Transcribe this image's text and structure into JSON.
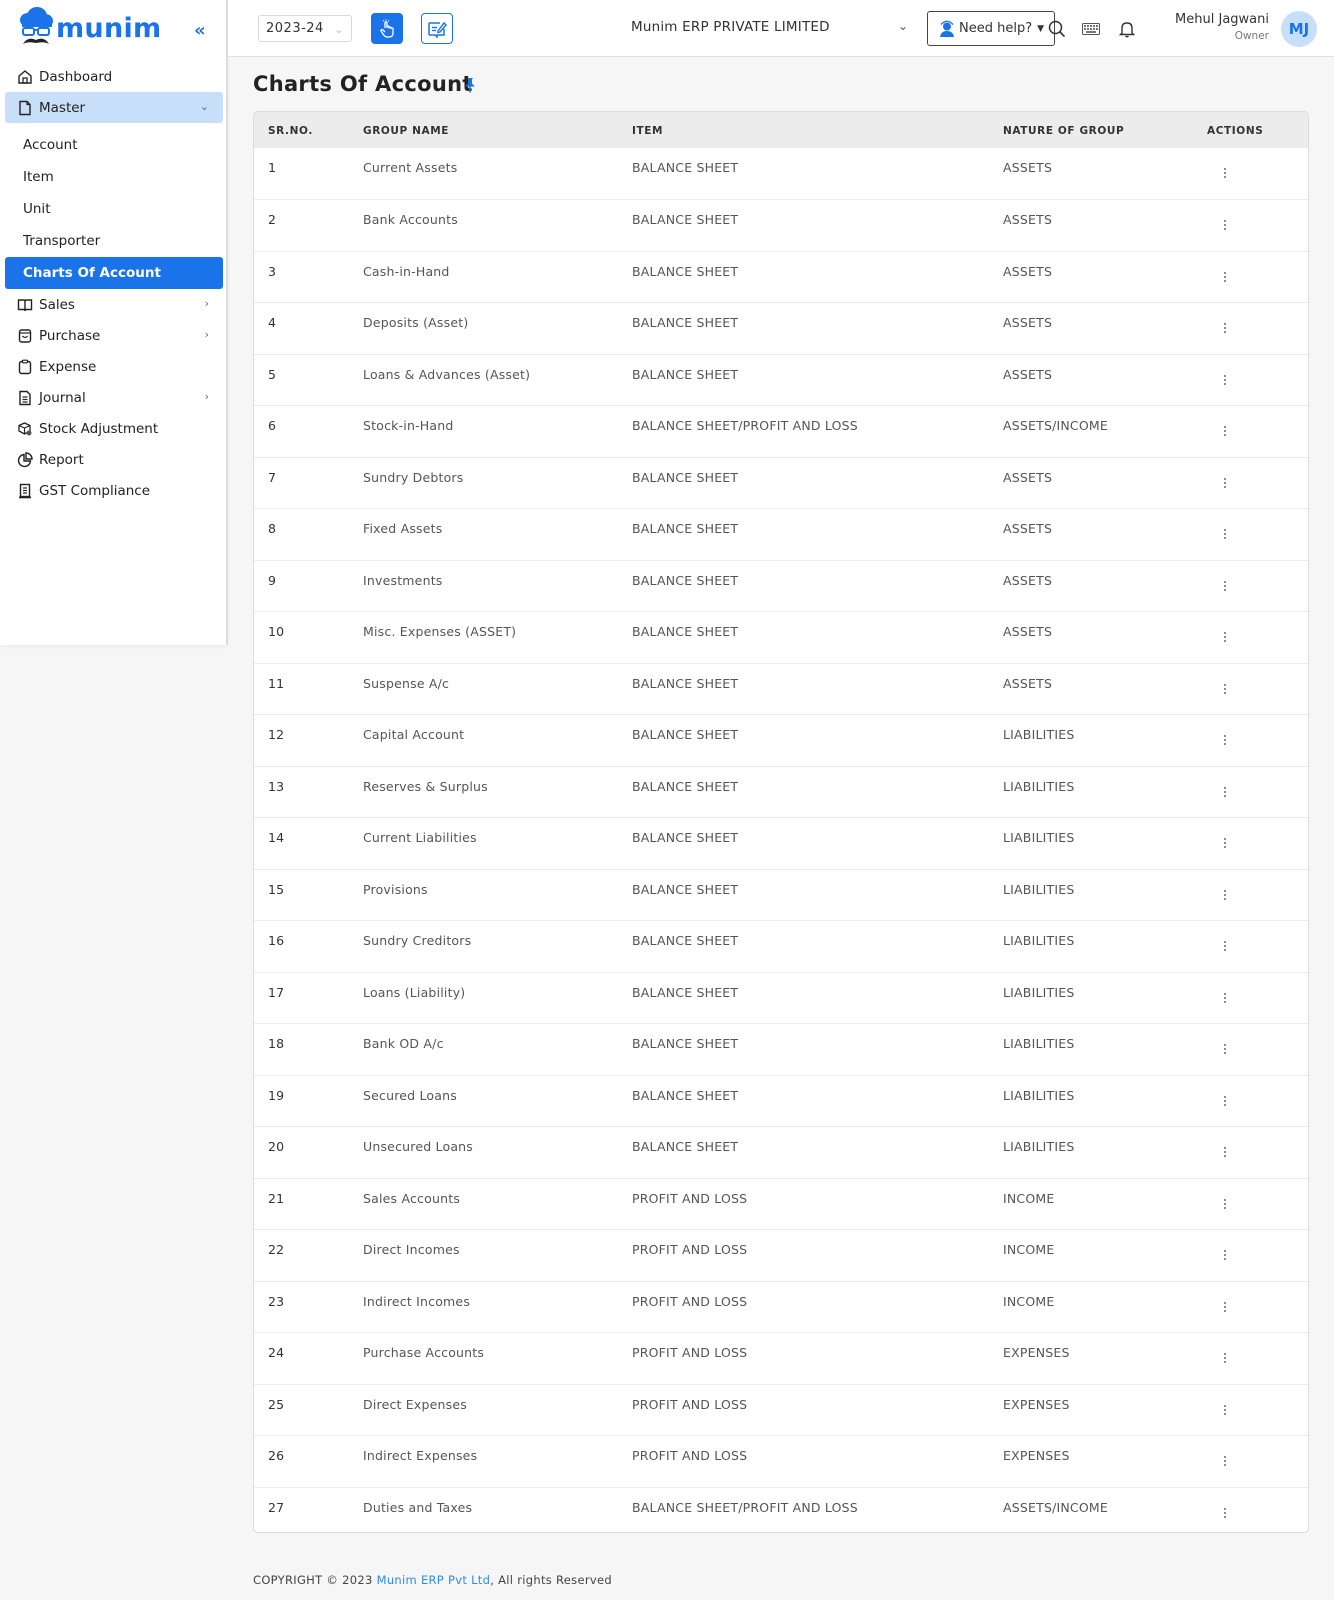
{
  "brand": {
    "name": "munim",
    "accent": "#1a73e8",
    "active_bg": "#1a73e8",
    "open_bg": "#c8dffa"
  },
  "sidebar": {
    "collapse_glyph": "«",
    "items": [
      {
        "label": "Dashboard",
        "icon": "home-icon"
      },
      {
        "label": "Master",
        "icon": "file-icon",
        "expanded": true
      },
      {
        "label": "Sales",
        "icon": "book-icon",
        "has_children": true
      },
      {
        "label": "Purchase",
        "icon": "bag-icon",
        "has_children": true
      },
      {
        "label": "Expense",
        "icon": "clipboard-icon"
      },
      {
        "label": "Journal",
        "icon": "document-icon",
        "has_children": true
      },
      {
        "label": "Stock Adjustment",
        "icon": "box-gear-icon"
      },
      {
        "label": "Report",
        "icon": "pie-chart-icon"
      },
      {
        "label": "GST Compliance",
        "icon": "scroll-icon"
      }
    ],
    "master_children": [
      {
        "label": "Account"
      },
      {
        "label": "Item"
      },
      {
        "label": "Unit"
      },
      {
        "label": "Transporter"
      },
      {
        "label": "Charts Of Account",
        "active": true
      }
    ]
  },
  "topbar": {
    "financial_year": "2023-24",
    "company": "Munim ERP PRIVATE LIMITED",
    "help_label": "Need help?",
    "user_name": "Mehul Jagwani",
    "user_role": "Owner",
    "avatar_initials": "MJ"
  },
  "page": {
    "title": "Charts Of Account"
  },
  "table": {
    "columns": [
      "SR.NO.",
      "GROUP NAME",
      "ITEM",
      "NATURE OF GROUP",
      "ACTIONS"
    ],
    "rows": [
      {
        "sr": "1",
        "group": "Current Assets",
        "item": "BALANCE SHEET",
        "nature": "ASSETS"
      },
      {
        "sr": "2",
        "group": "Bank Accounts",
        "item": "BALANCE SHEET",
        "nature": "ASSETS"
      },
      {
        "sr": "3",
        "group": "Cash-in-Hand",
        "item": "BALANCE SHEET",
        "nature": "ASSETS"
      },
      {
        "sr": "4",
        "group": "Deposits (Asset)",
        "item": "BALANCE SHEET",
        "nature": "ASSETS"
      },
      {
        "sr": "5",
        "group": "Loans & Advances (Asset)",
        "item": "BALANCE SHEET",
        "nature": "ASSETS"
      },
      {
        "sr": "6",
        "group": "Stock-in-Hand",
        "item": "BALANCE SHEET/PROFIT AND LOSS",
        "nature": "ASSETS/INCOME"
      },
      {
        "sr": "7",
        "group": "Sundry Debtors",
        "item": "BALANCE SHEET",
        "nature": "ASSETS"
      },
      {
        "sr": "8",
        "group": "Fixed Assets",
        "item": "BALANCE SHEET",
        "nature": "ASSETS"
      },
      {
        "sr": "9",
        "group": "Investments",
        "item": "BALANCE SHEET",
        "nature": "ASSETS"
      },
      {
        "sr": "10",
        "group": "Misc. Expenses (ASSET)",
        "item": "BALANCE SHEET",
        "nature": "ASSETS"
      },
      {
        "sr": "11",
        "group": "Suspense A/c",
        "item": "BALANCE SHEET",
        "nature": "ASSETS"
      },
      {
        "sr": "12",
        "group": "Capital Account",
        "item": "BALANCE SHEET",
        "nature": "LIABILITIES"
      },
      {
        "sr": "13",
        "group": "Reserves & Surplus",
        "item": "BALANCE SHEET",
        "nature": "LIABILITIES"
      },
      {
        "sr": "14",
        "group": "Current Liabilities",
        "item": "BALANCE SHEET",
        "nature": "LIABILITIES"
      },
      {
        "sr": "15",
        "group": "Provisions",
        "item": "BALANCE SHEET",
        "nature": "LIABILITIES"
      },
      {
        "sr": "16",
        "group": "Sundry Creditors",
        "item": "BALANCE SHEET",
        "nature": "LIABILITIES"
      },
      {
        "sr": "17",
        "group": "Loans (Liability)",
        "item": "BALANCE SHEET",
        "nature": "LIABILITIES"
      },
      {
        "sr": "18",
        "group": "Bank OD A/c",
        "item": "BALANCE SHEET",
        "nature": "LIABILITIES"
      },
      {
        "sr": "19",
        "group": "Secured Loans",
        "item": "BALANCE SHEET",
        "nature": "LIABILITIES"
      },
      {
        "sr": "20",
        "group": "Unsecured Loans",
        "item": "BALANCE SHEET",
        "nature": "LIABILITIES"
      },
      {
        "sr": "21",
        "group": "Sales Accounts",
        "item": "PROFIT AND LOSS",
        "nature": "INCOME"
      },
      {
        "sr": "22",
        "group": "Direct Incomes",
        "item": "PROFIT AND LOSS",
        "nature": "INCOME"
      },
      {
        "sr": "23",
        "group": "Indirect Incomes",
        "item": "PROFIT AND LOSS",
        "nature": "INCOME"
      },
      {
        "sr": "24",
        "group": "Purchase Accounts",
        "item": "PROFIT AND LOSS",
        "nature": "EXPENSES"
      },
      {
        "sr": "25",
        "group": "Direct Expenses",
        "item": "PROFIT AND LOSS",
        "nature": "EXPENSES"
      },
      {
        "sr": "26",
        "group": "Indirect Expenses",
        "item": "PROFIT AND LOSS",
        "nature": "EXPENSES"
      },
      {
        "sr": "27",
        "group": "Duties and Taxes",
        "item": "BALANCE SHEET/PROFIT AND LOSS",
        "nature": "ASSETS/INCOME"
      }
    ]
  },
  "footer": {
    "prefix": "COPYRIGHT © 2023 ",
    "link": "Munim ERP Pvt Ltd",
    "suffix": ", All rights Reserved"
  }
}
